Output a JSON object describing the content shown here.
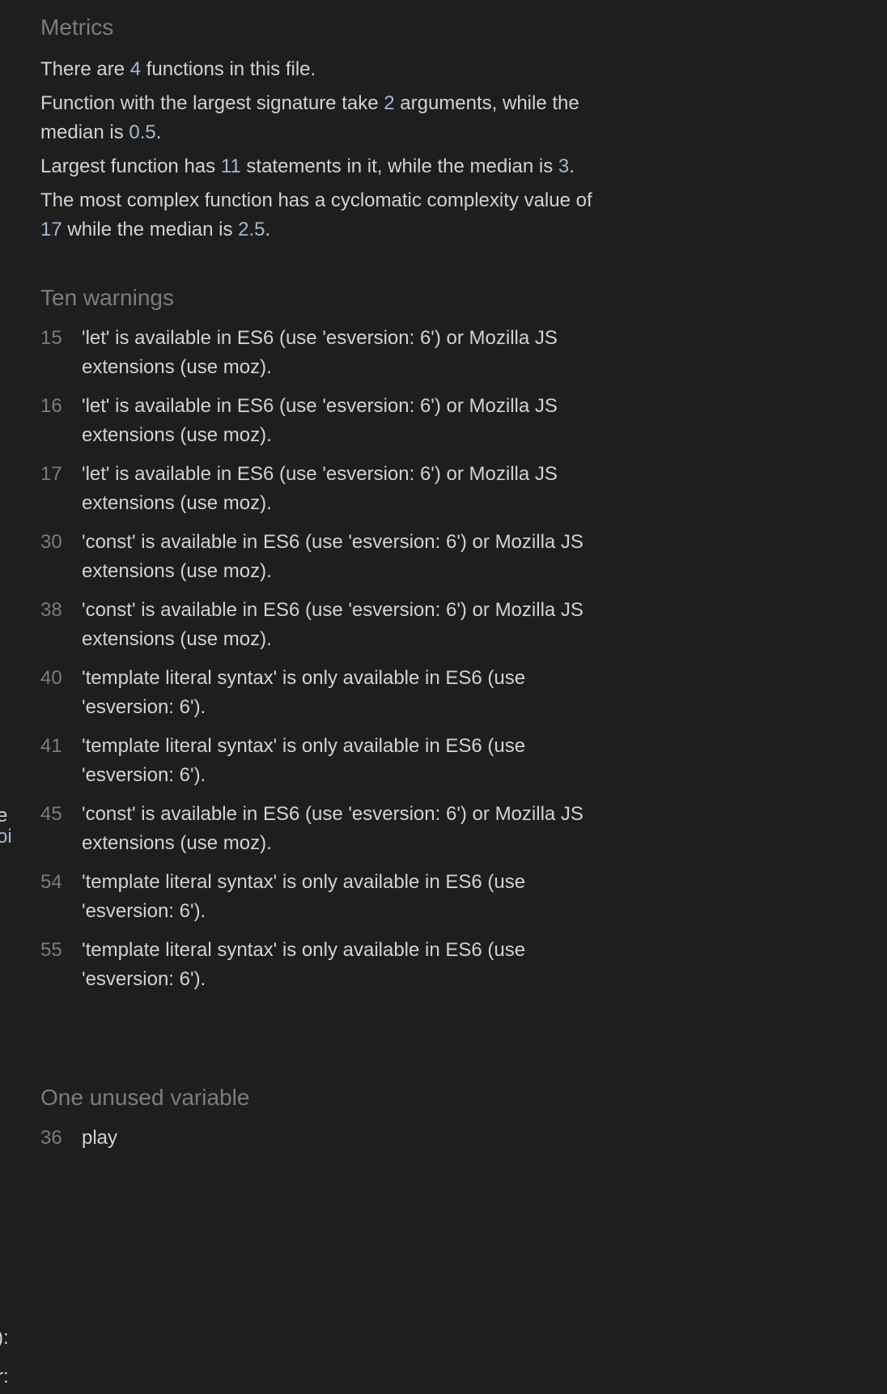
{
  "metrics": {
    "title": "Metrics",
    "lines": [
      {
        "pre": "There are ",
        "num": "4",
        "post": " functions in this file.",
        "pre2": "",
        "num2": "",
        "post2": ""
      },
      {
        "pre": "Function with the largest signature take ",
        "num": "2",
        "post": " arguments, while the median is ",
        "num2": "0.5",
        "post2": "."
      },
      {
        "pre": "Largest function has ",
        "num": "11",
        "post": " statements in it, while the median is ",
        "num2": "3",
        "post2": "."
      },
      {
        "pre": "The most complex function has a cyclomatic complexity value of ",
        "num": "17",
        "post": " while the median is ",
        "num2": "2.5",
        "post2": "."
      }
    ]
  },
  "warnings": {
    "title": "Ten warnings",
    "items": [
      {
        "line": "15",
        "message": "'let' is available in ES6 (use 'esversion: 6') or Mozilla JS extensions (use moz)."
      },
      {
        "line": "16",
        "message": "'let' is available in ES6 (use 'esversion: 6') or Mozilla JS extensions (use moz)."
      },
      {
        "line": "17",
        "message": "'let' is available in ES6 (use 'esversion: 6') or Mozilla JS extensions (use moz)."
      },
      {
        "line": "30",
        "message": "'const' is available in ES6 (use 'esversion: 6') or Mozilla JS extensions (use moz)."
      },
      {
        "line": "38",
        "message": "'const' is available in ES6 (use 'esversion: 6') or Mozilla JS extensions (use moz)."
      },
      {
        "line": "40",
        "message": "'template literal syntax' is only available in ES6 (use 'esversion: 6')."
      },
      {
        "line": "41",
        "message": "'template literal syntax' is only available in ES6 (use 'esversion: 6')."
      },
      {
        "line": "45",
        "message": "'const' is available in ES6 (use 'esversion: 6') or Mozilla JS extensions (use moz)."
      },
      {
        "line": "54",
        "message": "'template literal syntax' is only available in ES6 (use 'esversion: 6')."
      },
      {
        "line": "55",
        "message": "'template literal syntax' is only available in ES6 (use 'esversion: 6')."
      }
    ]
  },
  "unused": {
    "title": "One unused variable",
    "items": [
      {
        "line": "36",
        "name": "play"
      }
    ]
  },
  "edge_fragments": {
    "a": "e",
    "b": "oi",
    "c": "):",
    "d": "r:"
  }
}
